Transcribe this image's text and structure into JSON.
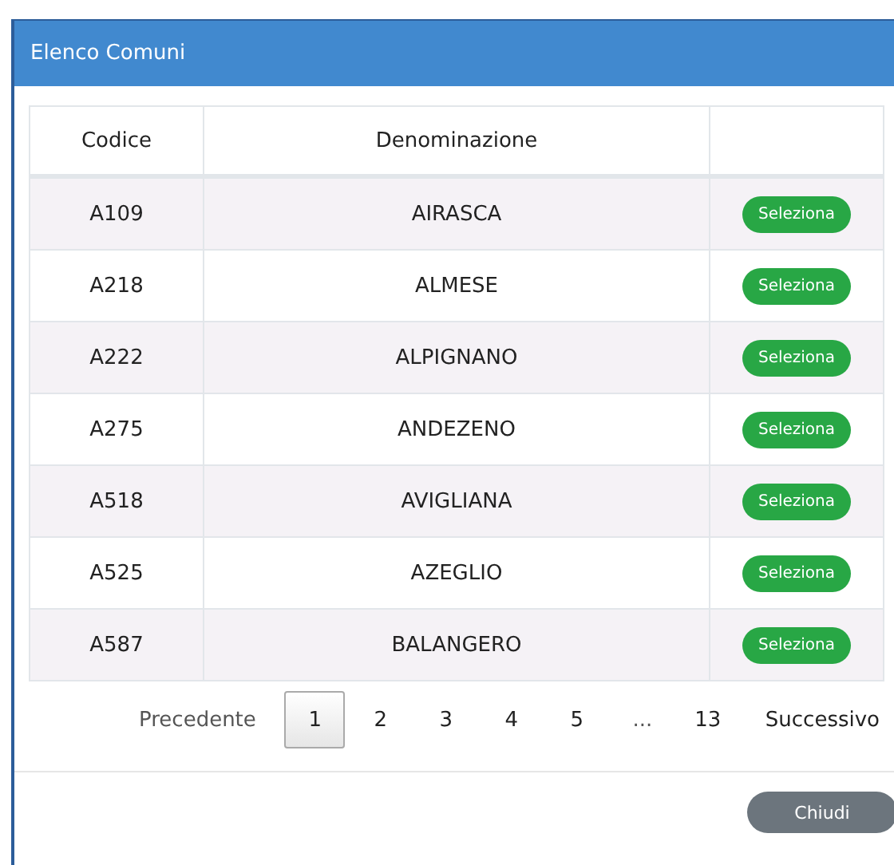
{
  "dialog": {
    "title": "Elenco Comuni"
  },
  "table": {
    "columns": [
      "Codice",
      "Denominazione"
    ],
    "rows": [
      {
        "code": "A109",
        "name": "AIRASCA",
        "action": "Seleziona"
      },
      {
        "code": "A218",
        "name": "ALMESE",
        "action": "Seleziona"
      },
      {
        "code": "A222",
        "name": "ALPIGNANO",
        "action": "Seleziona"
      },
      {
        "code": "A275",
        "name": "ANDEZENO",
        "action": "Seleziona"
      },
      {
        "code": "A518",
        "name": "AVIGLIANA",
        "action": "Seleziona"
      },
      {
        "code": "A525",
        "name": "AZEGLIO",
        "action": "Seleziona"
      },
      {
        "code": "A587",
        "name": "BALANGERO",
        "action": "Seleziona"
      }
    ]
  },
  "pagination": {
    "previous": "Precedente",
    "next": "Successivo",
    "pages": [
      {
        "label": "1",
        "kind": "page",
        "selected": true
      },
      {
        "label": "2",
        "kind": "page",
        "selected": false
      },
      {
        "label": "3",
        "kind": "page",
        "selected": false
      },
      {
        "label": "4",
        "kind": "page",
        "selected": false
      },
      {
        "label": "5",
        "kind": "page",
        "selected": false
      },
      {
        "label": "...",
        "kind": "ellipsis"
      },
      {
        "label": "13",
        "kind": "page",
        "selected": false
      }
    ]
  },
  "footer": {
    "close": "Chiudi"
  }
}
